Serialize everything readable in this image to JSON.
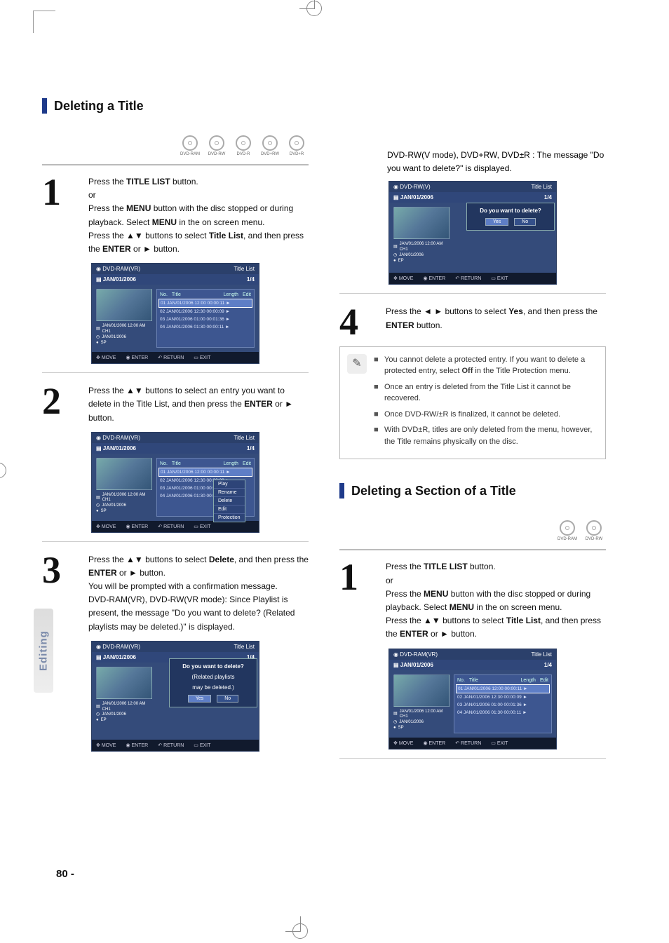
{
  "section1": {
    "title": "Deleting a Title"
  },
  "discs_row_top": [
    "DVD-RAM",
    "DVD-RW",
    "DVD-R",
    "DVD+RW",
    "DVD+R"
  ],
  "discs_row_bottom": [
    "DVD-RAM",
    "DVD-RW"
  ],
  "step1": {
    "num": "1",
    "line1a": "Press the ",
    "line1b": "TITLE LIST",
    "line1c": " button.",
    "line2": "or",
    "line3a": "Press the ",
    "line3b": "MENU",
    "line3c": " button with the disc stopped or during playback. Select ",
    "line3d": "MENU",
    "line3e": " in the on screen menu.",
    "line4a": "Press the ",
    "line4b": "▲▼",
    "line4c": " buttons to select ",
    "line4d": "Title List",
    "line4e": ", and then press the ",
    "line4f": "ENTER",
    "line4g": " or ",
    "line4h": "►",
    "line4i": " button."
  },
  "step2": {
    "num": "2",
    "a": "Press the ",
    "b": "▲▼",
    "c": " buttons to select an entry you want to delete in the Title List, and then press the ",
    "d": "ENTER",
    "e": " or ",
    "f": "►",
    "g": " button."
  },
  "step3": {
    "num": "3",
    "a": "Press the ",
    "b": "▲▼",
    "c": " buttons to select ",
    "d": "Delete",
    "e": ", and then press the ",
    "f": "ENTER",
    "g": " or ",
    "h": "►",
    "i": " button.",
    "sub1": "You will be prompted with a confirmation message.",
    "sub2": "DVD-RAM(VR), DVD-RW(VR mode): Since Playlist is present, the message \"Do you want to delete? (Related playlists may be deleted.)\" is displayed."
  },
  "ss_common": {
    "topbar_left_vr": "DVD-RAM(VR)",
    "topbar_left_v": "DVD-RW(V)",
    "topbar_right": "Title List",
    "topbar2_left": "JAN/01/2006",
    "topbar2_right": "1/4",
    "meta1": "JAN/01/2006 12:00 AM CH1",
    "meta2": "JAN/01/2006",
    "meta3": "SP",
    "meta3_ep": "EP",
    "head_no": "No.",
    "head_title": "Title",
    "head_length": "Length",
    "head_edit": "Edit",
    "rows": [
      "01  JAN/01/2006  12:00   00:00:11  ►",
      "02  JAN/01/2006  12:30   00:00:09  ►",
      "03  JAN/01/2006  01:00   00:01:36  ►",
      "04  JAN/01/2006  01:30   00:00:11  ►"
    ],
    "bottom_move": "MOVE",
    "bottom_enter": "ENTER",
    "bottom_return": "RETURN",
    "bottom_exit": "EXIT"
  },
  "submenu": {
    "items": [
      "Play",
      "Rename",
      "Delete",
      "Edit",
      "Protection"
    ]
  },
  "dialog_full": {
    "q1": "Do you want to delete?",
    "q2": "(Related playlists",
    "q3": "may be deleted.)",
    "yes": "Yes",
    "no": "No"
  },
  "dialog_simple": {
    "q1": "Do you want to delete?",
    "yes": "Yes",
    "no": "No"
  },
  "right_top_text": {
    "a": "DVD-RW(V mode), DVD+RW, DVD±R : The message \"Do you want to delete?\" is displayed."
  },
  "step4": {
    "num": "4",
    "a": "Press the ",
    "b": "◄ ►",
    "c": " buttons to select ",
    "d": "Yes",
    "e": ", and then press the ",
    "f": "ENTER",
    "g": " button."
  },
  "notes": {
    "n1a": "You cannot delete a protected entry. If you want to delete a protected entry, select ",
    "n1b": "Off",
    "n1c": " in the Title Protection menu.",
    "n2": "Once an entry is deleted from the Title List it cannot be recovered.",
    "n3": "Once DVD-RW/±R is finalized, it cannot be deleted.",
    "n4": "With DVD±R, titles are only deleted from the menu, however, the Title remains physically on the disc."
  },
  "section2": {
    "title": "Deleting a Section of a Title"
  },
  "step1b": {
    "num": "1",
    "line1a": "Press the ",
    "line1b": "TITLE LIST",
    "line1c": " button.",
    "line2": "or",
    "line3a": "Press the ",
    "line3b": "MENU",
    "line3c": " button with the disc stopped or during playback. Select ",
    "line3d": "MENU",
    "line3e": " in the on screen menu.",
    "line4a": "Press the ",
    "line4b": "▲▼",
    "line4c": " buttons to select ",
    "line4d": "Title List",
    "line4e": ", and then press the ",
    "line4f": "ENTER",
    "line4g": " or ",
    "line4h": "►",
    "line4i": " button."
  },
  "sidebar_label": "Editing",
  "page_number": "80 -",
  "icons": {
    "move": "✥",
    "enter": "◉",
    "return": "↶",
    "exit": "▭",
    "pencil": "✎",
    "list": "▤",
    "clock": "◷",
    "rec": "●"
  }
}
